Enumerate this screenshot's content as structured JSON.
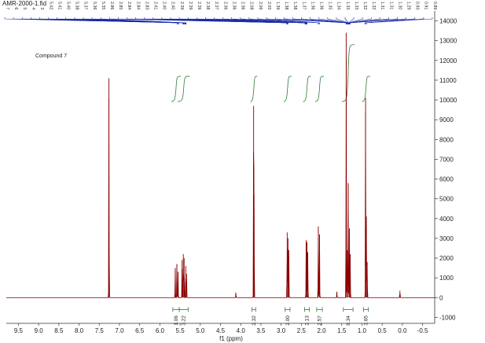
{
  "file_name": "AMR-2000-1.fid",
  "compound_label": "Compound 7",
  "chart_data": {
    "type": "line",
    "title": "",
    "xlabel": "f1 (ppm)",
    "ylabel": "",
    "xlim": [
      9.8,
      -0.8
    ],
    "ylim": [
      -1300,
      14500
    ],
    "x_reversed": true,
    "grid": false,
    "x_ticks": [
      9.5,
      9.0,
      8.5,
      8.0,
      7.5,
      7.0,
      6.5,
      6.0,
      5.5,
      5.0,
      4.5,
      4.0,
      3.5,
      3.0,
      2.5,
      2.0,
      1.5,
      1.0,
      0.5,
      0.0,
      -0.5
    ],
    "x_tick_labels": [
      "9.5",
      "9.0",
      "8.5",
      "8.0",
      "7.5",
      "7.0",
      "6.5",
      "6.0",
      "5.5",
      "5.0",
      "4.5",
      "4.0",
      "3.5",
      "3.0",
      "2.5",
      "2.0",
      "1.5",
      "1.0",
      "0.5",
      "0.0",
      "-0.5"
    ],
    "y_ticks": [
      -1000,
      0,
      1000,
      2000,
      3000,
      4000,
      5000,
      6000,
      7000,
      8000,
      9000,
      10000,
      11000,
      12000,
      13000,
      14000
    ],
    "y_tick_labels": [
      "-1000",
      "0",
      "1000",
      "2000",
      "3000",
      "4000",
      "5000",
      "6000",
      "7000",
      "8000",
      "9000",
      "10000",
      "11000",
      "12000",
      "13000",
      "14000"
    ],
    "peaks": [
      {
        "ppm": 7.26,
        "height": 11100
      },
      {
        "ppm": 5.62,
        "height": 1500
      },
      {
        "ppm": 5.58,
        "height": 1700
      },
      {
        "ppm": 5.55,
        "height": 1300
      },
      {
        "ppm": 5.45,
        "height": 1900
      },
      {
        "ppm": 5.42,
        "height": 2200
      },
      {
        "ppm": 5.4,
        "height": 2000
      },
      {
        "ppm": 5.36,
        "height": 1600
      },
      {
        "ppm": 5.34,
        "height": 1200
      },
      {
        "ppm": 4.12,
        "height": 250
      },
      {
        "ppm": 3.68,
        "height": 9700
      },
      {
        "ppm": 3.67,
        "height": 5200
      },
      {
        "ppm": 2.85,
        "height": 3300
      },
      {
        "ppm": 2.83,
        "height": 3000
      },
      {
        "ppm": 2.81,
        "height": 2400
      },
      {
        "ppm": 2.38,
        "height": 2900
      },
      {
        "ppm": 2.36,
        "height": 2800
      },
      {
        "ppm": 2.34,
        "height": 2300
      },
      {
        "ppm": 2.08,
        "height": 3600
      },
      {
        "ppm": 2.05,
        "height": 3200
      },
      {
        "ppm": 1.62,
        "height": 300
      },
      {
        "ppm": 1.39,
        "height": 13400
      },
      {
        "ppm": 1.36,
        "height": 2400
      },
      {
        "ppm": 1.34,
        "height": 5800
      },
      {
        "ppm": 1.31,
        "height": 3500
      },
      {
        "ppm": 1.29,
        "height": 2200
      },
      {
        "ppm": 0.91,
        "height": 10100
      },
      {
        "ppm": 0.89,
        "height": 4100
      },
      {
        "ppm": 0.87,
        "height": 1800
      },
      {
        "ppm": 0.06,
        "height": 350
      }
    ],
    "integrals": [
      {
        "label": "1.06",
        "from": 5.68,
        "to": 5.52
      },
      {
        "label": "3.22",
        "from": 5.52,
        "to": 5.3
      },
      {
        "label": "2.32",
        "from": 3.72,
        "to": 3.63
      },
      {
        "label": "2.00",
        "from": 2.9,
        "to": 2.78
      },
      {
        "label": "2.13",
        "from": 2.42,
        "to": 2.3
      },
      {
        "label": "2.57",
        "from": 2.12,
        "to": 1.98
      },
      {
        "label": "8.34",
        "from": 1.46,
        "to": 1.22
      },
      {
        "label": "3.65",
        "from": 0.96,
        "to": 0.84
      }
    ],
    "peak_labels": [
      "5.57",
      "5.56",
      "5.55",
      "5.54",
      "5.43",
      "5.42",
      "5.41",
      "5.40",
      "5.38",
      "5.37",
      "5.36",
      "5.35",
      "2.86",
      "2.85",
      "2.84",
      "2.84",
      "2.83",
      "2.41",
      "2.40",
      "2.40",
      "2.39",
      "2.39",
      "2.39",
      "2.38",
      "2.37",
      "2.36",
      "2.36",
      "2.36",
      "2.08",
      "2.06",
      "2.05",
      "1.39",
      "1.38",
      "1.38",
      "1.37",
      "1.36",
      "1.36",
      "1.35",
      "1.34",
      "1.33",
      "1.33",
      "1.32",
      "1.32",
      "1.31",
      "1.31",
      "1.30",
      "1.29",
      "0.93",
      "0.91",
      "0.89"
    ]
  }
}
